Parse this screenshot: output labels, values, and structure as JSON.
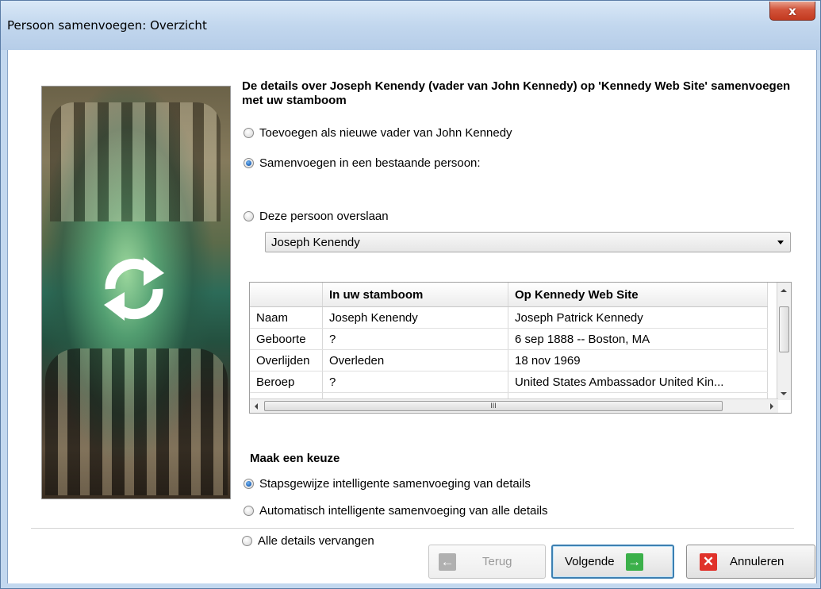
{
  "window": {
    "title": "Persoon samenvoegen: Overzicht",
    "close_glyph": "x"
  },
  "heading": "De details over Joseph Kenendy (vader van John Kennedy) op 'Kennedy Web Site' samenvoegen met uw stamboom",
  "merge_options": [
    {
      "label": "Toevoegen als nieuwe vader van John Kennedy",
      "checked": false
    },
    {
      "label": "Samenvoegen in een bestaande persoon:",
      "checked": true
    },
    {
      "label": "Deze persoon overslaan",
      "checked": false
    }
  ],
  "existing_person_select": {
    "value": "Joseph Kenendy"
  },
  "details_table": {
    "headers": [
      "",
      "In uw stamboom",
      "Op Kennedy Web Site"
    ],
    "rows": [
      [
        "Naam",
        "Joseph Kenendy",
        "Joseph Patrick Kennedy"
      ],
      [
        "Geboorte",
        "?",
        "6 sep 1888 -- Boston, MA"
      ],
      [
        "Overlijden",
        "Overleden",
        "18 nov 1969"
      ],
      [
        "Beroep",
        "?",
        "United States Ambassador United Kin..."
      ],
      [
        "R...",
        "?",
        "R..."
      ]
    ],
    "hscroll_grip": "III"
  },
  "choice_section": {
    "label": "Maak een keuze",
    "options": [
      {
        "label": "Stapsgewijze intelligente samenvoeging van details",
        "checked": true
      },
      {
        "label": "Automatisch intelligente samenvoeging van alle details",
        "checked": false
      },
      {
        "label": "Alle details vervangen",
        "checked": false
      }
    ]
  },
  "buttons": {
    "back": {
      "label": "Terug",
      "icon": "arrow-left-icon",
      "glyph": "←",
      "enabled": false
    },
    "next": {
      "label": "Volgende",
      "icon": "arrow-right-icon",
      "glyph": "→",
      "enabled": true
    },
    "cancel": {
      "label": "Annuleren",
      "icon": "close-icon",
      "glyph": "✕",
      "enabled": true
    }
  },
  "colors": {
    "accent_next": "#3bb04a",
    "accent_cancel": "#e0322a",
    "radio_checked": "#2a6fc2"
  }
}
